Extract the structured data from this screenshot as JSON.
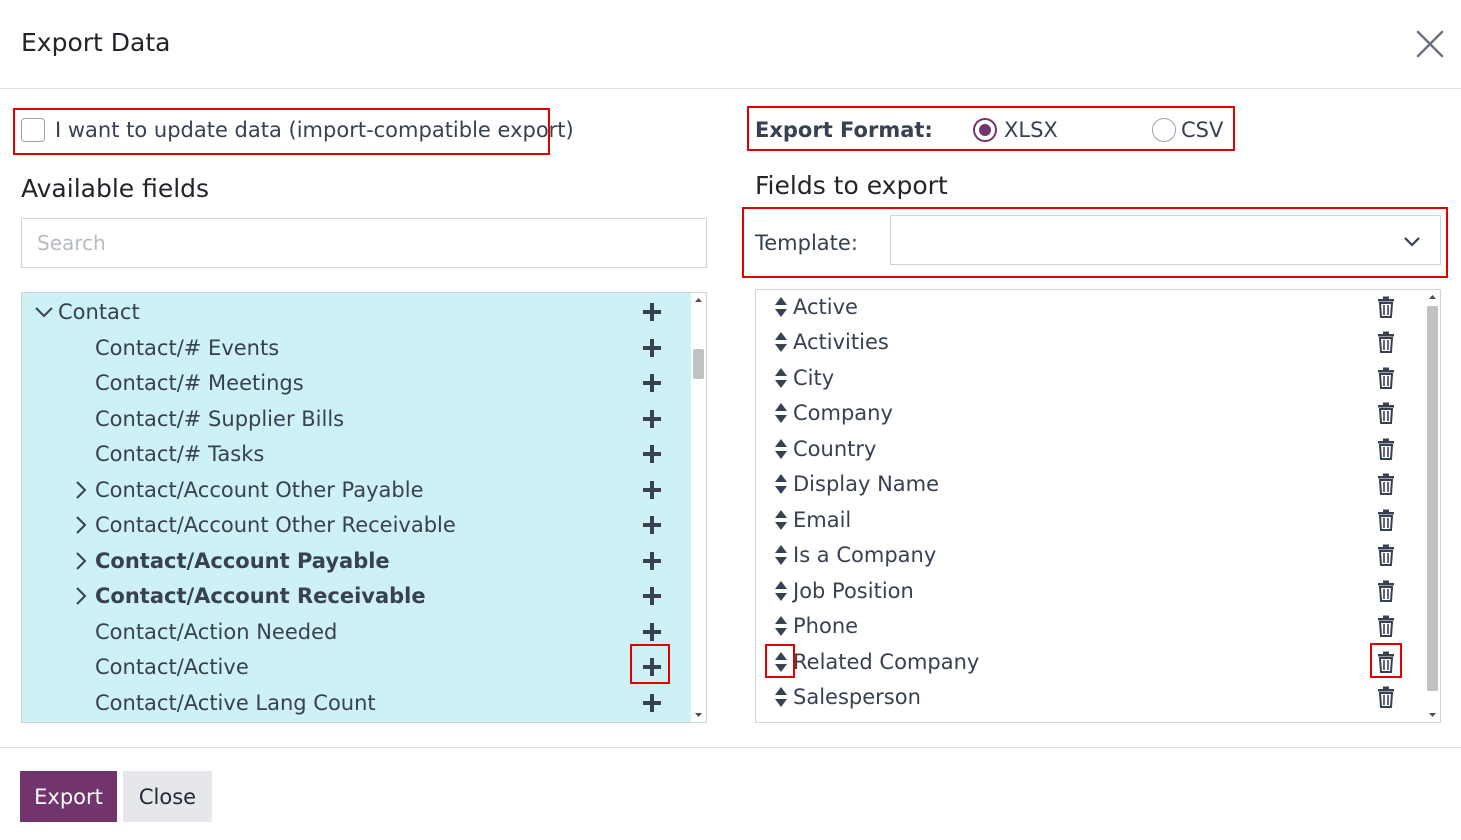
{
  "dialog": {
    "title": "Export Data"
  },
  "import_compatible": {
    "label": "I want to update data (import-compatible export)",
    "checked": false
  },
  "available_fields": {
    "title": "Available fields",
    "search_placeholder": "Search",
    "items": [
      {
        "label": "Contact",
        "level": 0,
        "expander": "expanded",
        "bold": false
      },
      {
        "label": "Contact/# Events",
        "level": 1,
        "expander": "none",
        "bold": false
      },
      {
        "label": "Contact/# Meetings",
        "level": 1,
        "expander": "none",
        "bold": false
      },
      {
        "label": "Contact/# Supplier Bills",
        "level": 1,
        "expander": "none",
        "bold": false
      },
      {
        "label": "Contact/# Tasks",
        "level": 1,
        "expander": "none",
        "bold": false
      },
      {
        "label": "Contact/Account Other Payable",
        "level": 1,
        "expander": "collapsed",
        "bold": false
      },
      {
        "label": "Contact/Account Other Receivable",
        "level": 1,
        "expander": "collapsed",
        "bold": false
      },
      {
        "label": "Contact/Account Payable",
        "level": 1,
        "expander": "collapsed",
        "bold": true
      },
      {
        "label": "Contact/Account Receivable",
        "level": 1,
        "expander": "collapsed",
        "bold": true
      },
      {
        "label": "Contact/Action Needed",
        "level": 1,
        "expander": "none",
        "bold": false
      },
      {
        "label": "Contact/Active",
        "level": 1,
        "expander": "none",
        "bold": false
      },
      {
        "label": "Contact/Active Lang Count",
        "level": 1,
        "expander": "none",
        "bold": false
      }
    ]
  },
  "export_format": {
    "label": "Export Format:",
    "options": [
      {
        "label": "XLSX",
        "selected": true
      },
      {
        "label": "CSV",
        "selected": false
      }
    ]
  },
  "fields_to_export": {
    "title": "Fields to export",
    "template_label": "Template:",
    "template_value": "",
    "items": [
      {
        "label": "Active"
      },
      {
        "label": "Activities"
      },
      {
        "label": "City"
      },
      {
        "label": "Company"
      },
      {
        "label": "Country"
      },
      {
        "label": "Display Name"
      },
      {
        "label": "Email"
      },
      {
        "label": "Is a Company"
      },
      {
        "label": "Job Position"
      },
      {
        "label": "Phone"
      },
      {
        "label": "Related Company"
      },
      {
        "label": "Salesperson"
      }
    ]
  },
  "footer": {
    "export_label": "Export",
    "close_label": "Close"
  },
  "colors": {
    "primary": "#71346d",
    "highlight_border": "#e00000",
    "tree_background": "#cdf1f4"
  }
}
